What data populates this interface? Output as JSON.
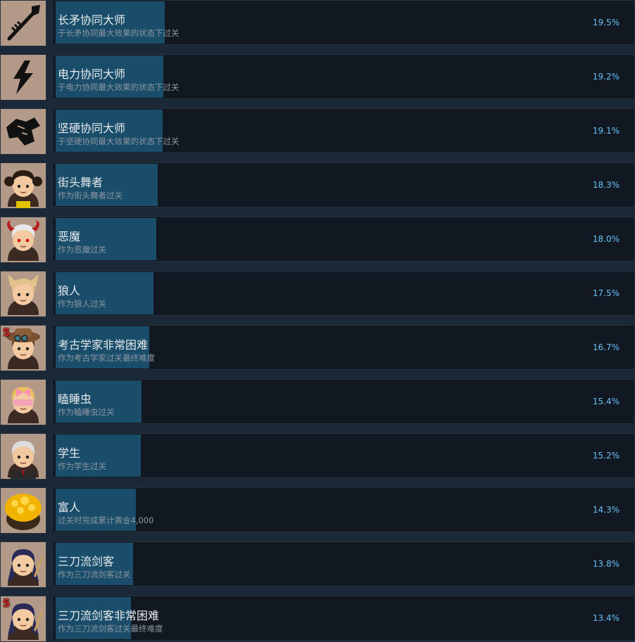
{
  "achievements": [
    {
      "title": "长矛协同大师",
      "description": "于长矛协同最大效果的状态下过关",
      "percent": "19.5%",
      "percent_value": 19.5,
      "icon": "spear-icon",
      "icon_bg": "#b39a88"
    },
    {
      "title": "电力协同大师",
      "description": "于电力协同最大效果的状态下过关",
      "percent": "19.2%",
      "percent_value": 19.2,
      "icon": "lightning-icon",
      "icon_bg": "#b39a88"
    },
    {
      "title": "坚硬协同大师",
      "description": "于坚硬协同最大效果的状态下过关",
      "percent": "19.1%",
      "percent_value": 19.1,
      "icon": "armor-fist-icon",
      "icon_bg": "#b39a88"
    },
    {
      "title": "街头舞者",
      "description": "作为街头舞者过关",
      "percent": "18.3%",
      "percent_value": 18.3,
      "icon": "street-dancer-portrait-icon",
      "icon_bg": "#b39a88"
    },
    {
      "title": "恶魔",
      "description": "作为恶魔过关",
      "percent": "18.0%",
      "percent_value": 18.0,
      "icon": "demon-portrait-icon",
      "icon_bg": "#b39a88"
    },
    {
      "title": "狼人",
      "description": "作为狼人过关",
      "percent": "17.5%",
      "percent_value": 17.5,
      "icon": "werewolf-portrait-icon",
      "icon_bg": "#b39a88"
    },
    {
      "title": "考古学家非常困难",
      "description": "作为考古学家过关最终难度",
      "percent": "16.7%",
      "percent_value": 16.7,
      "icon": "archaeologist-portrait-icon",
      "icon_bg": "#b39a88",
      "difficulty_badge": "5"
    },
    {
      "title": "瞌睡虫",
      "description": "作为瞌睡虫过关",
      "percent": "15.4%",
      "percent_value": 15.4,
      "icon": "sleepyhead-portrait-icon",
      "icon_bg": "#b39a88"
    },
    {
      "title": "学生",
      "description": "作为学生过关",
      "percent": "15.2%",
      "percent_value": 15.2,
      "icon": "student-portrait-icon",
      "icon_bg": "#b39a88"
    },
    {
      "title": "富人",
      "description": "过关时完成累计黄金4,000",
      "percent": "14.3%",
      "percent_value": 14.3,
      "icon": "gold-pot-icon",
      "icon_bg": "#b39a88"
    },
    {
      "title": "三刀流剑客",
      "description": "作为三刀流剑客过关",
      "percent": "13.8%",
      "percent_value": 13.8,
      "icon": "swordsman-portrait-icon",
      "icon_bg": "#b39a88"
    },
    {
      "title": "三刀流剑客非常困难",
      "description": "作为三刀流剑客过关最终难度",
      "percent": "13.4%",
      "percent_value": 13.4,
      "icon": "swordsman-hard-portrait-icon",
      "icon_bg": "#b39a88",
      "difficulty_badge": "5"
    }
  ],
  "colors": {
    "progress_bar": "#1a4d6a",
    "percent_text": "#66c0f4",
    "page_bg": "#1b2838"
  }
}
